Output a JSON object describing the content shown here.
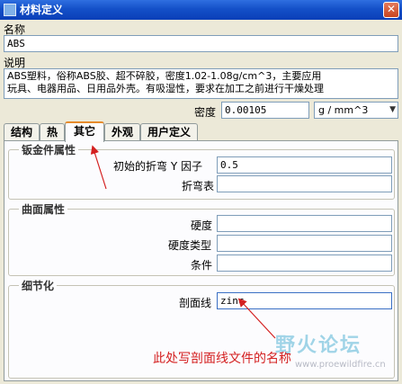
{
  "window": {
    "title": "材料定义"
  },
  "name": {
    "label": "名称",
    "value": "ABS"
  },
  "description": {
    "label": "说明",
    "line1": "ABS塑料，俗称ABS胶、超不碎胶，密度1.02-1.08g/cm^3，主要应用",
    "line2": "玩具、电器用品、日用品外壳。有吸湿性，要求在加工之前进行干燥处理"
  },
  "density": {
    "label": "密度",
    "value": "0.00105",
    "unit": "g / mm^3"
  },
  "tabs": [
    {
      "label": "结构"
    },
    {
      "label": "热"
    },
    {
      "label": "其它"
    },
    {
      "label": "外观"
    },
    {
      "label": "用户定义"
    }
  ],
  "sheetmetal": {
    "title": "钣金件属性",
    "yfactor_label": "初始的折弯 Y 因子",
    "yfactor_value": "0.5",
    "bendtable_label": "折弯表",
    "bendtable_value": ""
  },
  "surface": {
    "title": "曲面属性",
    "hardness_label": "硬度",
    "hardness_value": "",
    "hardness_type_label": "硬度类型",
    "hardness_type_value": "",
    "condition_label": "条件",
    "condition_value": ""
  },
  "detailing": {
    "title": "细节化",
    "xhatch_label": "剖面线",
    "xhatch_value": "zinc"
  },
  "annotation": {
    "text": "此处写剖面线文件的名称"
  },
  "watermark": {
    "text": "野火论坛",
    "url": "www.proewildfire.cn"
  },
  "colors": {
    "annotation": "#d42020",
    "titlebar": "#1450c8"
  }
}
